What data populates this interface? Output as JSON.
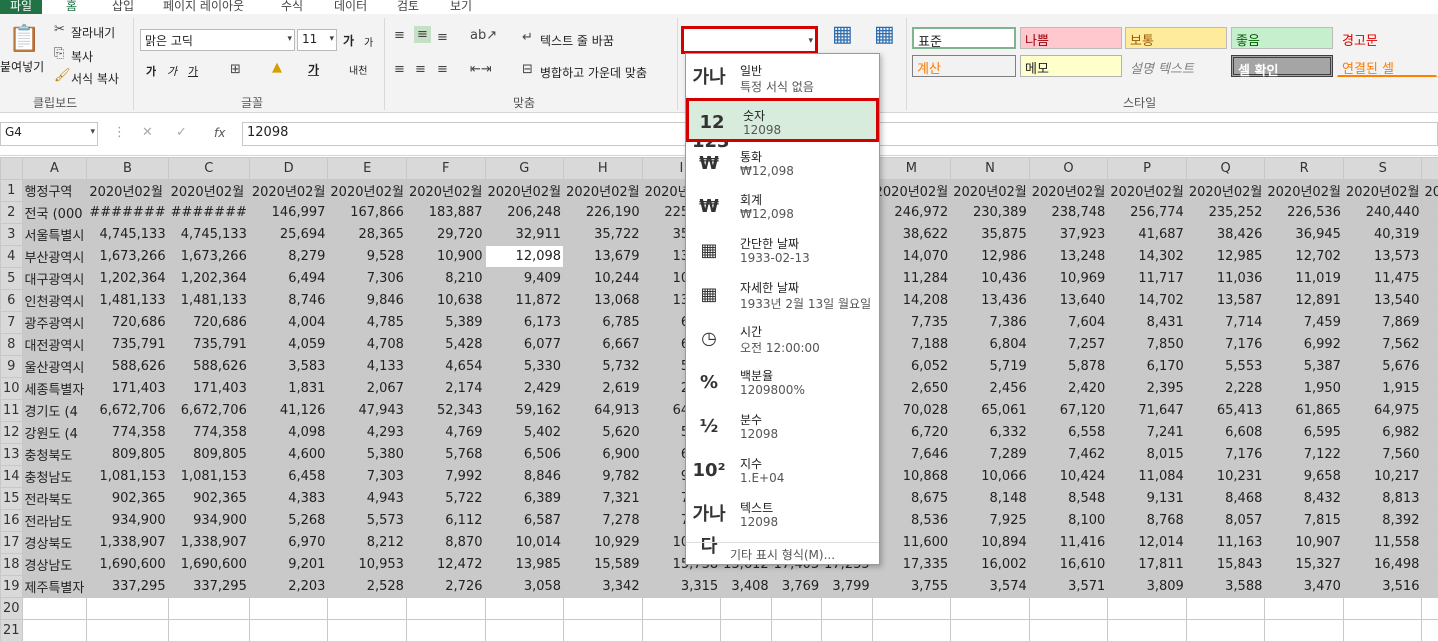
{
  "tabs": [
    "파일",
    "홈",
    "삽입",
    "페이지 레이아웃",
    "수식",
    "데이터",
    "검토",
    "보기"
  ],
  "clipboard": {
    "paste": "붙여넣기",
    "cut": "잘라내기",
    "copy": "복사",
    "painter": "서식 복사",
    "label": "클립보드"
  },
  "font": {
    "name": "맑은 고딕",
    "size": "11",
    "label": "글꼴",
    "grow": "가",
    "shrink": "가",
    "bold": "가",
    "italic": "가",
    "underline": "가",
    "color_a": "가",
    "phonetic": "내천"
  },
  "align": {
    "wrap": "텍스트 줄 바꿈",
    "merge": "병합하고 가운데 맞춤",
    "label": "맞춤"
  },
  "number": {
    "format_value": ""
  },
  "styles": {
    "label": "스타일",
    "r1": [
      "표준",
      "나쁨",
      "보통",
      "좋음",
      "경고문"
    ],
    "r2": [
      "계산",
      "메모",
      "설명 텍스트",
      "셀 확인",
      "연결된 셀"
    ]
  },
  "formula": {
    "namebox": "G4",
    "fx": "fx",
    "value": "12098"
  },
  "columns": [
    "A",
    "B",
    "C",
    "D",
    "E",
    "F",
    "G",
    "H",
    "I",
    "J",
    "K",
    "L",
    "M",
    "N",
    "O",
    "P",
    "Q",
    "R",
    "S",
    "T"
  ],
  "rows": [
    [
      "1",
      "행정구역",
      "2020년02월",
      "2020년02월",
      "2020년02월",
      "2020년02월",
      "2020년02월",
      "2020년02월",
      "2020년02월",
      "2020년02월",
      "",
      "",
      "",
      "2020년02월",
      "2020년02월",
      "2020년02월",
      "2020년02월",
      "2020년02월",
      "2020년02월",
      "2020년02월",
      "2020년02"
    ],
    [
      "2",
      "전국  (000",
      "#######",
      "#######",
      "146,997",
      "167,866",
      "183,887",
      "206,248",
      "226,190",
      "225,301",
      "",
      "",
      "7",
      "246,972",
      "230,389",
      "238,748",
      "256,774",
      "235,252",
      "226,536",
      "240,440",
      "255,"
    ],
    [
      "3",
      "서울특별시",
      "4,745,133",
      "4,745,133",
      "25,694",
      "28,365",
      "29,720",
      "32,911",
      "35,722",
      "35,371",
      "",
      "",
      "3",
      "38,622",
      "35,875",
      "37,923",
      "41,687",
      "38,426",
      "36,945",
      "40,319",
      "42,"
    ],
    [
      "4",
      "부산광역시",
      "1,673,266",
      "1,673,266",
      "8,279",
      "9,528",
      "10,900",
      "12,098",
      "13,679",
      "13,472",
      "",
      "",
      "5",
      "14,070",
      "12,986",
      "13,248",
      "14,302",
      "12,985",
      "12,702",
      "13,573",
      "14,"
    ],
    [
      "5",
      "대구광역시",
      "1,202,364",
      "1,202,364",
      "6,494",
      "7,306",
      "8,210",
      "9,409",
      "10,244",
      "10,219",
      "",
      "",
      "0",
      "11,284",
      "10,436",
      "10,969",
      "11,717",
      "11,036",
      "11,019",
      "11,475",
      "12,"
    ],
    [
      "6",
      "인천광역시",
      "1,481,133",
      "1,481,133",
      "8,746",
      "9,846",
      "10,638",
      "11,872",
      "13,068",
      "13,197",
      "",
      "",
      "4",
      "14,208",
      "13,436",
      "13,640",
      "14,702",
      "13,587",
      "12,891",
      "13,540",
      "14,"
    ],
    [
      "7",
      "광주광역시",
      "720,686",
      "720,686",
      "4,004",
      "4,785",
      "5,389",
      "6,173",
      "6,785",
      "6,959",
      "",
      "",
      "6",
      "7,735",
      "7,386",
      "7,604",
      "8,431",
      "7,714",
      "7,459",
      "7,869",
      "8,"
    ],
    [
      "8",
      "대전광역시",
      "735,791",
      "735,791",
      "4,059",
      "4,708",
      "5,428",
      "6,077",
      "6,667",
      "6,627",
      "",
      "",
      "6",
      "7,188",
      "6,804",
      "7,257",
      "7,850",
      "7,176",
      "6,992",
      "7,562",
      "7,"
    ],
    [
      "9",
      "울산광역시",
      "588,626",
      "588,626",
      "3,583",
      "4,133",
      "4,654",
      "5,330",
      "5,732",
      "5,826",
      "",
      "",
      "8",
      "6,052",
      "5,719",
      "5,878",
      "6,170",
      "5,553",
      "5,387",
      "5,676",
      "6,"
    ],
    [
      "10",
      "세종특별자",
      "171,403",
      "171,403",
      "1,831",
      "2,067",
      "2,174",
      "2,429",
      "2,619",
      "2,585",
      "",
      "",
      "5",
      "2,650",
      "2,456",
      "2,420",
      "2,395",
      "2,228",
      "1,950",
      "1,915",
      "1,"
    ],
    [
      "11",
      "경기도  (4",
      "6,672,706",
      "6,672,706",
      "41,126",
      "47,943",
      "52,343",
      "59,162",
      "64,913",
      "64,509",
      "",
      "",
      "3",
      "70,028",
      "65,061",
      "67,120",
      "71,647",
      "65,413",
      "61,865",
      "64,975",
      "68,"
    ],
    [
      "12",
      "강원도  (4",
      "774,358",
      "774,358",
      "4,098",
      "4,293",
      "4,769",
      "5,402",
      "5,620",
      "5,724",
      "",
      "",
      "7",
      "6,720",
      "6,332",
      "6,558",
      "7,241",
      "6,608",
      "6,595",
      "6,982",
      "7,"
    ],
    [
      "13",
      "충청북도",
      "809,805",
      "809,805",
      "4,600",
      "5,380",
      "5,768",
      "6,506",
      "6,900",
      "6,666",
      "",
      "",
      "2",
      "7,646",
      "7,289",
      "7,462",
      "8,015",
      "7,176",
      "7,122",
      "7,560",
      "7,"
    ],
    [
      "14",
      "충청남도",
      "1,081,153",
      "1,081,153",
      "6,458",
      "7,303",
      "7,992",
      "8,846",
      "9,782",
      "9,539",
      "",
      "",
      "3",
      "10,868",
      "10,066",
      "10,424",
      "11,084",
      "10,231",
      "9,658",
      "10,217",
      "10,"
    ],
    [
      "15",
      "전라북도",
      "902,365",
      "902,365",
      "4,383",
      "4,943",
      "5,722",
      "6,389",
      "7,321",
      "7,436",
      "",
      "",
      "6",
      "8,675",
      "8,148",
      "8,548",
      "9,131",
      "8,468",
      "8,432",
      "8,813",
      "9,"
    ],
    [
      "16",
      "전라남도",
      "934,900",
      "934,900",
      "5,268",
      "5,573",
      "6,112",
      "6,587",
      "7,278",
      "7,211",
      "",
      "",
      "3",
      "8,536",
      "7,925",
      "8,100",
      "8,768",
      "8,057",
      "7,815",
      "8,392",
      "9,"
    ],
    [
      "17",
      "경상북도",
      "1,338,907",
      "1,338,907",
      "6,970",
      "8,212",
      "8,870",
      "10,014",
      "10,929",
      "10,907",
      "",
      "",
      "3",
      "11,600",
      "10,894",
      "11,416",
      "12,014",
      "11,163",
      "10,907",
      "11,558",
      "12,"
    ],
    [
      "18",
      "경상남도",
      "1,690,600",
      "1,690,600",
      "9,201",
      "10,953",
      "12,472",
      "13,985",
      "15,589",
      "15,738",
      "13,612",
      "17,403",
      "17,235",
      "17,335",
      "16,002",
      "16,610",
      "17,811",
      "15,843",
      "15,327",
      "16,498",
      "17,"
    ],
    [
      "19",
      "제주특별자",
      "337,295",
      "337,295",
      "2,203",
      "2,528",
      "2,726",
      "3,058",
      "3,342",
      "3,315",
      "3,408",
      "3,769",
      "3,799",
      "3,755",
      "3,574",
      "3,571",
      "3,809",
      "3,588",
      "3,470",
      "3,516",
      "3,"
    ],
    [
      "20",
      "",
      "",
      "",
      "",
      "",
      "",
      "",
      "",
      "",
      "",
      "",
      "",
      "",
      "",
      "",
      "",
      "",
      "",
      "",
      ""
    ],
    [
      "21",
      "",
      "",
      "",
      "",
      "",
      "",
      "",
      "",
      "",
      "",
      "",
      "",
      "",
      "",
      "",
      "",
      "",
      "",
      "",
      ""
    ]
  ],
  "dropdown": {
    "items": [
      {
        "icon": "가나다 123",
        "name": "일반",
        "example": "특정 서식 없음"
      },
      {
        "icon": "12",
        "name": "숫자",
        "example": "12098"
      },
      {
        "icon": "₩",
        "name": "통화",
        "example": "₩12,098"
      },
      {
        "icon": "₩",
        "name": "회계",
        "example": " ₩12,098"
      },
      {
        "icon": "▦",
        "name": "간단한 날짜",
        "example": "1933-02-13"
      },
      {
        "icon": "▦",
        "name": "자세한 날짜",
        "example": "1933년 2월 13일 월요일"
      },
      {
        "icon": "◷",
        "name": "시간",
        "example": "오전 12:00:00"
      },
      {
        "icon": "%",
        "name": "백분율",
        "example": "1209800%"
      },
      {
        "icon": "½",
        "name": "분수",
        "example": "12098"
      },
      {
        "icon": "10²",
        "name": "지수",
        "example": "1.E+04"
      },
      {
        "icon": "가나다",
        "name": "텍스트",
        "example": "12098"
      }
    ],
    "footer": "기타 표시 형식(M)..."
  }
}
